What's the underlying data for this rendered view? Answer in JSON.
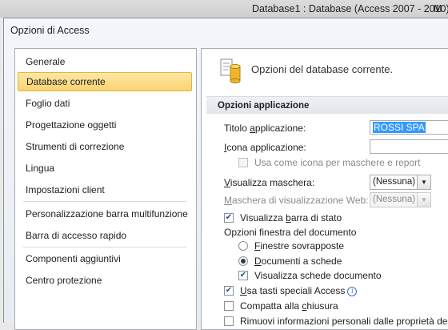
{
  "background_window": {
    "title": "Database1 : Database (Access 2007 - 2010)  -",
    "title_extra": "M"
  },
  "dialog": {
    "title": "Opzioni di Access"
  },
  "nav": {
    "items": [
      {
        "label": "Generale"
      },
      {
        "label": "Database corrente",
        "selected": true
      },
      {
        "label": "Foglio dati"
      },
      {
        "label": "Progettazione oggetti"
      },
      {
        "label": "Strumenti di correzione"
      },
      {
        "label": "Lingua"
      },
      {
        "label": "Impostazioni client"
      },
      {
        "label": "Personalizzazione barra multifunzione"
      },
      {
        "label": "Barra di accesso rapido"
      },
      {
        "label": "Componenti aggiuntivi"
      },
      {
        "label": "Centro protezione"
      }
    ]
  },
  "panel": {
    "header": "Opzioni del database corrente.",
    "section": "Opzioni applicazione",
    "app_title_label": "Titolo applicazione:",
    "app_title_value": "ROSSI SPA",
    "app_icon_label": "Icona applicazione:",
    "app_icon_value": "",
    "use_icon_label": "Usa come icona per maschere e report",
    "display_form_label": "Visualizza maschera:",
    "display_form_value": "(Nessuna)",
    "web_form_label": "Maschera di visualizzazione Web:",
    "web_form_value": "(Nessuna)",
    "status_bar_label": "Visualizza barra di stato",
    "status_bar_checked": true,
    "doc_window_label": "Opzioni finestra del documento",
    "overlap_label": "Finestre sovrapposte",
    "tabbed_label": "Documenti a schede",
    "tabbed_selected": true,
    "doc_tabs_label": "Visualizza schede documento",
    "doc_tabs_checked": true,
    "special_keys_label": "Usa tasti speciali Access",
    "special_keys_checked": true,
    "compact_label": "Compatta alla chiusura",
    "compact_checked": false,
    "remove_info_label": "Rimuovi informazioni personali dalle proprietà del f"
  }
}
